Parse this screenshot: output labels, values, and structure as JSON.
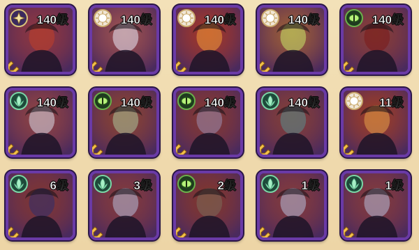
{
  "heroes": [
    {
      "level_label": "140级",
      "faction_icon": "star-gold-badge",
      "portrait_color": "#4a2a5e",
      "accent": "#c0402a"
    },
    {
      "level_label": "140级",
      "faction_icon": "sun-white-badge",
      "portrait_color": "#6a6c86",
      "accent": "#e8e6f4"
    },
    {
      "level_label": "140级",
      "faction_icon": "sun-white-badge",
      "portrait_color": "#7a2a22",
      "accent": "#f29a3a"
    },
    {
      "level_label": "140级",
      "faction_icon": "sun-white-badge",
      "portrait_color": "#6a8c48",
      "accent": "#c9e46a"
    },
    {
      "level_label": "140级",
      "faction_icon": "eye-green-badge",
      "portrait_color": "#3c3c46",
      "accent": "#7a1a1a"
    },
    {
      "level_label": "140级",
      "faction_icon": "leaf-green-badge",
      "portrait_color": "#4a4a66",
      "accent": "#d8d8e6"
    },
    {
      "level_label": "140级",
      "faction_icon": "eye-green-badge",
      "portrait_color": "#3c4a3a",
      "accent": "#a9c39a"
    },
    {
      "level_label": "140级",
      "faction_icon": "eye-green-badge",
      "portrait_color": "#2e2e3a",
      "accent": "#9a8cb0"
    },
    {
      "level_label": "140级",
      "faction_icon": "leaf-green-badge",
      "portrait_color": "#2c3e4a",
      "accent": "#5a8c8c"
    },
    {
      "level_label": "11级",
      "faction_icon": "sun-white-badge",
      "portrait_color": "#6a3a1e",
      "accent": "#e6a04a"
    },
    {
      "level_label": "6级",
      "faction_icon": "leaf-green-badge",
      "portrait_color": "#25283e",
      "accent": "#2e2e6e"
    },
    {
      "level_label": "3级",
      "faction_icon": "leaf-green-badge",
      "portrait_color": "#2e3456",
      "accent": "#b4bcd8"
    },
    {
      "level_label": "2级",
      "faction_icon": "eye-green-badge",
      "portrait_color": "#2a2a2e",
      "accent": "#7a6a5a"
    },
    {
      "level_label": "1级",
      "faction_icon": "leaf-green-badge",
      "portrait_color": "#2e3456",
      "accent": "#b4bcd8"
    },
    {
      "level_label": "1级",
      "faction_icon": "leaf-green-badge",
      "portrait_color": "#2e3456",
      "accent": "#b4bcd8"
    }
  ]
}
